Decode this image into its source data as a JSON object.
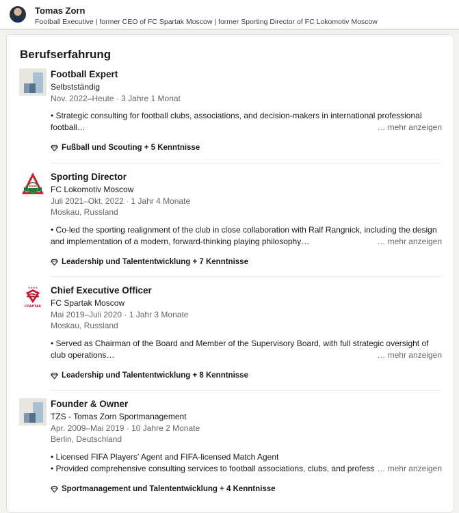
{
  "profile": {
    "name": "Tomas Zorn",
    "headline": "Football Executive | former CEO of FC Spartak Moscow | former Sporting Director of FC Lokomotiv Moscow"
  },
  "section": {
    "title": "Berufserfahrung"
  },
  "experience": [
    {
      "title": "Football Expert",
      "company": "Selbstständig",
      "dates": "Nov. 2022–Heute · 3 Jahre 1 Monat",
      "location": "",
      "description_lines": [
        "• Strategic consulting for football clubs, associations, and decision-makers in international professional",
        "football…"
      ],
      "more_label": "… mehr anzeigen",
      "skills": "Fußball und Scouting + 5 Kenntnisse",
      "logo_icon": "placeholder-company-icon"
    },
    {
      "title": "Sporting Director",
      "company": "FC Lokomotiv Moscow",
      "dates": "Juli 2021–Okt. 2022 · 1 Jahr 4 Monate",
      "location": "Moskau, Russland",
      "description_lines": [
        "• Co-led the sporting realignment of the club in close collaboration with Ralf Rangnick, including the design",
        "and implementation of a modern, forward-thinking playing philosophy…"
      ],
      "more_label": "… mehr anzeigen",
      "skills": "Leadership und Talententwicklung + 7 Kenntnisse",
      "logo_icon": "lokomotiv-logo-icon"
    },
    {
      "title": "Chief Executive Officer",
      "company": "FC Spartak Moscow",
      "dates": "Mai 2019–Juli 2020 · 1 Jahr 3 Monate",
      "location": "Moskau, Russland",
      "description_lines": [
        "• Served as Chairman of the Board and Member of the Supervisory Board, with full strategic oversight of",
        "club operations…"
      ],
      "more_label": "… mehr anzeigen",
      "skills": "Leadership und Talententwicklung + 8 Kenntnisse",
      "logo_icon": "spartak-logo-icon",
      "logo_text": "СПАРТАК"
    },
    {
      "title": "Founder & Owner",
      "company": "TZS - Tomas Zorn Sportmanagement",
      "dates": "Apr. 2009–Mai 2019 · 10 Jahre 2 Monate",
      "location": "Berlin, Deutschland",
      "description_lines": [
        "• Licensed FIFA Players' Agent and FIFA-licensed Match Agent",
        "• Provided comprehensive consulting services to football associations, clubs, and professi"
      ],
      "more_label": "… mehr anzeigen",
      "skills": "Sportmanagement und Talententwicklung + 4 Kenntnisse",
      "logo_icon": "placeholder-company-icon"
    }
  ]
}
